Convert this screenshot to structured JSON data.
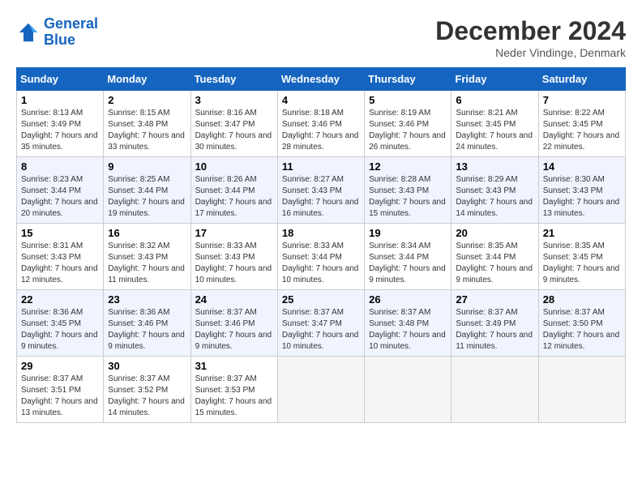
{
  "header": {
    "logo_line1": "General",
    "logo_line2": "Blue",
    "month": "December 2024",
    "location": "Neder Vindinge, Denmark"
  },
  "days_of_week": [
    "Sunday",
    "Monday",
    "Tuesday",
    "Wednesday",
    "Thursday",
    "Friday",
    "Saturday"
  ],
  "weeks": [
    [
      {
        "day": "1",
        "info": "Sunrise: 8:13 AM\nSunset: 3:49 PM\nDaylight: 7 hours and 35 minutes."
      },
      {
        "day": "2",
        "info": "Sunrise: 8:15 AM\nSunset: 3:48 PM\nDaylight: 7 hours and 33 minutes."
      },
      {
        "day": "3",
        "info": "Sunrise: 8:16 AM\nSunset: 3:47 PM\nDaylight: 7 hours and 30 minutes."
      },
      {
        "day": "4",
        "info": "Sunrise: 8:18 AM\nSunset: 3:46 PM\nDaylight: 7 hours and 28 minutes."
      },
      {
        "day": "5",
        "info": "Sunrise: 8:19 AM\nSunset: 3:46 PM\nDaylight: 7 hours and 26 minutes."
      },
      {
        "day": "6",
        "info": "Sunrise: 8:21 AM\nSunset: 3:45 PM\nDaylight: 7 hours and 24 minutes."
      },
      {
        "day": "7",
        "info": "Sunrise: 8:22 AM\nSunset: 3:45 PM\nDaylight: 7 hours and 22 minutes."
      }
    ],
    [
      {
        "day": "8",
        "info": "Sunrise: 8:23 AM\nSunset: 3:44 PM\nDaylight: 7 hours and 20 minutes."
      },
      {
        "day": "9",
        "info": "Sunrise: 8:25 AM\nSunset: 3:44 PM\nDaylight: 7 hours and 19 minutes."
      },
      {
        "day": "10",
        "info": "Sunrise: 8:26 AM\nSunset: 3:44 PM\nDaylight: 7 hours and 17 minutes."
      },
      {
        "day": "11",
        "info": "Sunrise: 8:27 AM\nSunset: 3:43 PM\nDaylight: 7 hours and 16 minutes."
      },
      {
        "day": "12",
        "info": "Sunrise: 8:28 AM\nSunset: 3:43 PM\nDaylight: 7 hours and 15 minutes."
      },
      {
        "day": "13",
        "info": "Sunrise: 8:29 AM\nSunset: 3:43 PM\nDaylight: 7 hours and 14 minutes."
      },
      {
        "day": "14",
        "info": "Sunrise: 8:30 AM\nSunset: 3:43 PM\nDaylight: 7 hours and 13 minutes."
      }
    ],
    [
      {
        "day": "15",
        "info": "Sunrise: 8:31 AM\nSunset: 3:43 PM\nDaylight: 7 hours and 12 minutes."
      },
      {
        "day": "16",
        "info": "Sunrise: 8:32 AM\nSunset: 3:43 PM\nDaylight: 7 hours and 11 minutes."
      },
      {
        "day": "17",
        "info": "Sunrise: 8:33 AM\nSunset: 3:43 PM\nDaylight: 7 hours and 10 minutes."
      },
      {
        "day": "18",
        "info": "Sunrise: 8:33 AM\nSunset: 3:44 PM\nDaylight: 7 hours and 10 minutes."
      },
      {
        "day": "19",
        "info": "Sunrise: 8:34 AM\nSunset: 3:44 PM\nDaylight: 7 hours and 9 minutes."
      },
      {
        "day": "20",
        "info": "Sunrise: 8:35 AM\nSunset: 3:44 PM\nDaylight: 7 hours and 9 minutes."
      },
      {
        "day": "21",
        "info": "Sunrise: 8:35 AM\nSunset: 3:45 PM\nDaylight: 7 hours and 9 minutes."
      }
    ],
    [
      {
        "day": "22",
        "info": "Sunrise: 8:36 AM\nSunset: 3:45 PM\nDaylight: 7 hours and 9 minutes."
      },
      {
        "day": "23",
        "info": "Sunrise: 8:36 AM\nSunset: 3:46 PM\nDaylight: 7 hours and 9 minutes."
      },
      {
        "day": "24",
        "info": "Sunrise: 8:37 AM\nSunset: 3:46 PM\nDaylight: 7 hours and 9 minutes."
      },
      {
        "day": "25",
        "info": "Sunrise: 8:37 AM\nSunset: 3:47 PM\nDaylight: 7 hours and 10 minutes."
      },
      {
        "day": "26",
        "info": "Sunrise: 8:37 AM\nSunset: 3:48 PM\nDaylight: 7 hours and 10 minutes."
      },
      {
        "day": "27",
        "info": "Sunrise: 8:37 AM\nSunset: 3:49 PM\nDaylight: 7 hours and 11 minutes."
      },
      {
        "day": "28",
        "info": "Sunrise: 8:37 AM\nSunset: 3:50 PM\nDaylight: 7 hours and 12 minutes."
      }
    ],
    [
      {
        "day": "29",
        "info": "Sunrise: 8:37 AM\nSunset: 3:51 PM\nDaylight: 7 hours and 13 minutes."
      },
      {
        "day": "30",
        "info": "Sunrise: 8:37 AM\nSunset: 3:52 PM\nDaylight: 7 hours and 14 minutes."
      },
      {
        "day": "31",
        "info": "Sunrise: 8:37 AM\nSunset: 3:53 PM\nDaylight: 7 hours and 15 minutes."
      },
      {
        "day": "",
        "info": ""
      },
      {
        "day": "",
        "info": ""
      },
      {
        "day": "",
        "info": ""
      },
      {
        "day": "",
        "info": ""
      }
    ]
  ]
}
